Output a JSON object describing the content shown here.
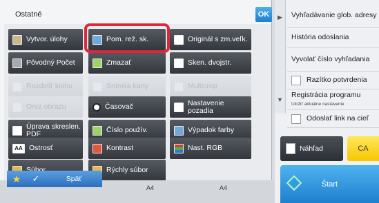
{
  "dialog": {
    "title": "Ostatné",
    "ok_label": "OK"
  },
  "buttons": [
    {
      "label": "Vytvor. úlohy",
      "disabled": false
    },
    {
      "label": "Pom. rež. sk.",
      "disabled": false
    },
    {
      "label": "Originál s zm.veľk.",
      "disabled": false
    },
    {
      "label": "Pôvodný Počet",
      "disabled": false
    },
    {
      "label": "Zmazať",
      "disabled": false
    },
    {
      "label": "Sken. dvojstr.",
      "disabled": false
    },
    {
      "label": "Rozdeliť knihu",
      "disabled": true
    },
    {
      "label": "Snímka karty",
      "disabled": true
    },
    {
      "label": "Multicrop",
      "disabled": true
    },
    {
      "label": "Orez obrazu",
      "disabled": true
    },
    {
      "label": "Časovač",
      "disabled": false
    },
    {
      "label": "Nastavenie pozadia",
      "disabled": false
    },
    {
      "label": "Úprava skreslen. PDF",
      "disabled": false
    },
    {
      "label": "Číslo použív.",
      "disabled": false
    },
    {
      "label": "Výpadok farby",
      "disabled": false
    },
    {
      "label": "Ostrosť",
      "disabled": false
    },
    {
      "label": "Kontrast",
      "disabled": false
    },
    {
      "label": "Nast. RGB",
      "disabled": false
    },
    {
      "label": "Súbor",
      "disabled": false
    },
    {
      "label": "Rýchly súbor",
      "disabled": false
    }
  ],
  "right_panel": {
    "items": [
      "Vyhľadávanie glob. adresy",
      "História odoslania",
      "Vyvolať číslo vyhľadania",
      "Razítko potvrdenia",
      "Registrácia programu",
      "Odoslať link na cieľ"
    ],
    "registration_sub": "Uložiť aktuálne nastavenie"
  },
  "actions": {
    "preview_label": "Náhľad",
    "ca_label": "CA",
    "start_label": "Štart"
  },
  "bottom": {
    "back_label": "Späť",
    "paper_left": "A4",
    "paper_right": "A4",
    "star_glyph": "★",
    "check_glyph": "✓"
  },
  "colors": {
    "highlight": "#e0263a",
    "accent_blue": "#1e7fcf",
    "ca_yellow": "#f6c700"
  }
}
